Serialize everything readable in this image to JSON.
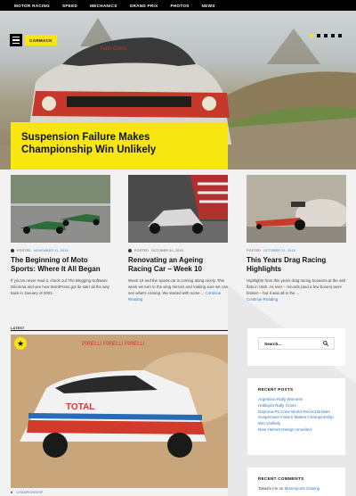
{
  "nav": {
    "items": [
      "MOTOR RACING",
      "SPEED",
      "MECHANICS",
      "GRAND PRIX",
      "PHOTOS",
      "NEWS"
    ]
  },
  "header": {
    "logo": "CARMACK"
  },
  "hero": {
    "title": "Suspension Failure Makes Championship Win Unlikely"
  },
  "cards": [
    {
      "meta_prefix": "POSTED",
      "date": "NOVEMBER 11, 2015",
      "title": "The Beginning of Moto Sports: Where It All Began",
      "excerpt": "If you've never read it, check out The Blogging Software Dilemma and see how WordPress got its start all the way back in January of 2003."
    },
    {
      "meta_prefix": "POSTED",
      "date": "OCTOBER 30, 2015",
      "title": "Renovating an Ageing Racing Car – Week 10",
      "excerpt": "Week 10 and the sports car is coming along nicely. This week we turn to the wing mirrors and making sure we can see what's coming. We started with some ...",
      "more": "Continue Reading"
    },
    {
      "meta_prefix": "POSTED",
      "date": "OCTOBER 21, 2015",
      "title": "This Years Drag Racing Highlights",
      "excerpt": "Highlights from this years drag racing bonanza at the salt flats in Utah. As ever – records (and a few bones) were broken – but it was all in the ...",
      "more": "Continue Reading"
    }
  ],
  "latest": {
    "label": "LATEST",
    "category": "CHAMPIONSHIP"
  },
  "sidebar": {
    "search_placeholder": "Search...",
    "recent_posts_title": "RECENT POSTS",
    "recent_posts": [
      "Argentina Rally Winners!",
      "Hobbyist Rally Cross",
      "Daytona Pit Crew World Record Broken",
      "Suspension Failure Makes Championship Win Unlikely",
      "New Helmet Design Unveiled"
    ],
    "recent_comments_title": "RECENT COMMENTS",
    "comment_author": "Takashi Irie",
    "comment_on": "on",
    "comment_post": "Motorsports Gaining"
  },
  "colors": {
    "accent": "#f7e60f",
    "link": "#2f7bbf",
    "dark": "#000000"
  }
}
